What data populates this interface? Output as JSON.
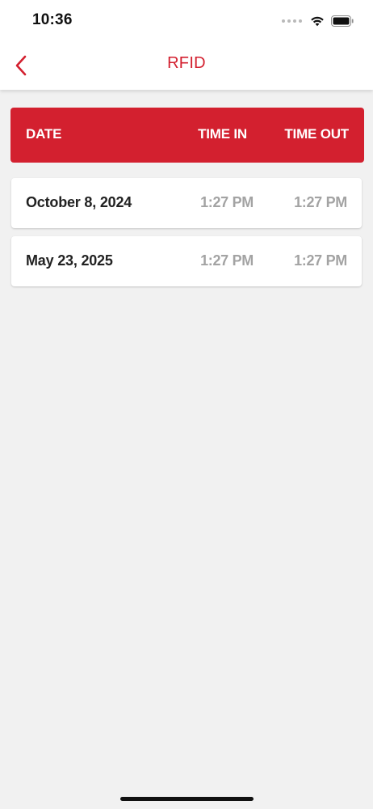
{
  "status_bar": {
    "time": "10:36",
    "icons": [
      "signal-dots-icon",
      "wifi-icon",
      "battery-icon"
    ]
  },
  "header": {
    "title": "RFID",
    "back_icon": "chevron-left-icon"
  },
  "table": {
    "columns": [
      "DATE",
      "TIME IN",
      "TIME OUT"
    ],
    "rows": [
      {
        "date": "October 8, 2024",
        "time_in": "1:27 PM",
        "time_out": "1:27 PM"
      },
      {
        "date": "May 23, 2025",
        "time_in": "1:27 PM",
        "time_out": "1:27 PM"
      }
    ]
  },
  "colors": {
    "accent": "#d3202f",
    "background": "#f1f1f1",
    "muted_text": "#a3a3a3"
  }
}
